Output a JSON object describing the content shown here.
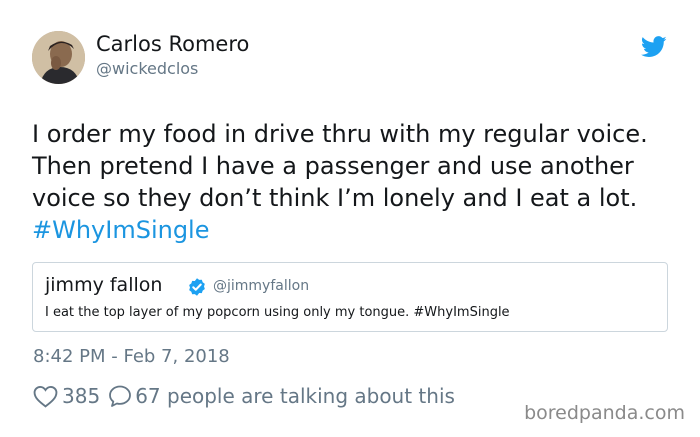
{
  "tweet": {
    "author_name": "Carlos Romero",
    "author_handle": "@wickedclos",
    "text": "I order my food in drive thru with my regular voice.\nThen pretend I have a passenger and use another\nvoice so they don’t think I’m lonely and I eat a lot.",
    "hashtag": "#WhyImSingle",
    "timestamp": "8:42 PM - Feb 7, 2018",
    "likes": "385",
    "replies_text": "67 people are talking about this"
  },
  "quote": {
    "name": "jimmy fallon",
    "handle": "@jimmyfallon",
    "text": "I eat the top layer of my popcorn using only my tongue. #WhyImSingle",
    "verified": true
  },
  "watermark": "boredpanda.com",
  "colors": {
    "twitter_blue": "#1da1f2",
    "hashtag": "#1b95e0",
    "secondary_text": "#657786",
    "border": "#ccd6dd"
  },
  "icons": {
    "brand": "twitter-bird-icon",
    "verified": "verified-badge-icon",
    "like": "heart-icon",
    "reply": "reply-bubble-icon"
  }
}
